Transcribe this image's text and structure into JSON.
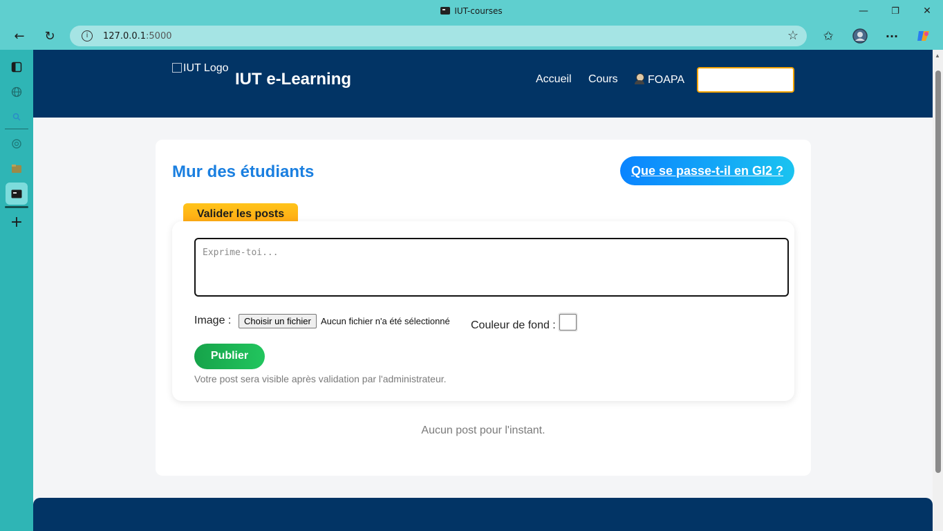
{
  "window": {
    "title": "IUT-courses",
    "controls": {
      "minimize": "—",
      "restore": "❐",
      "close": "✕"
    }
  },
  "browser": {
    "back_icon": "←",
    "reload_icon": "↻",
    "info_icon": "i",
    "url_host": "127.0.0.1",
    "url_port": ":5000",
    "favorite_icon": "☆",
    "favorites_icon": "✩",
    "more_icon": "···"
  },
  "sidebar": {
    "items": [
      "tab-actions-icon",
      "globe-icon",
      "search-icon",
      "chatgpt-icon",
      "folder-icon",
      "terminal-tab-icon",
      "add-tab-icon"
    ],
    "add_label": "+"
  },
  "header": {
    "logo_alt": "IUT Logo",
    "brand": "IUT e-Learning",
    "nav": {
      "home": "Accueil",
      "courses": "Cours",
      "user": "FOAPA"
    },
    "search_value": ""
  },
  "wall": {
    "title": "Mur des étudiants",
    "gi2_button": "Que se passe-t-il en GI2 ?",
    "validate_tab": "Valider les posts",
    "textarea_placeholder": "Exprime-toi...",
    "image_label": "Image :",
    "file_button": "Choisir un fichier",
    "file_status": "Aucun fichier n'a été sélectionné",
    "color_label": "Couleur de fond :",
    "color_value": "#ffffff",
    "publish_button": "Publier",
    "publish_note": "Votre post sera visible après validation par l'administrateur.",
    "empty_message": "Aucun post pour l'instant."
  },
  "colors": {
    "header_bg": "#023465",
    "title_blue": "#1a7fe0",
    "publish_green": "#16a34a",
    "validate_orange": "#ffa312",
    "input_border_orange": "#f5a300"
  }
}
